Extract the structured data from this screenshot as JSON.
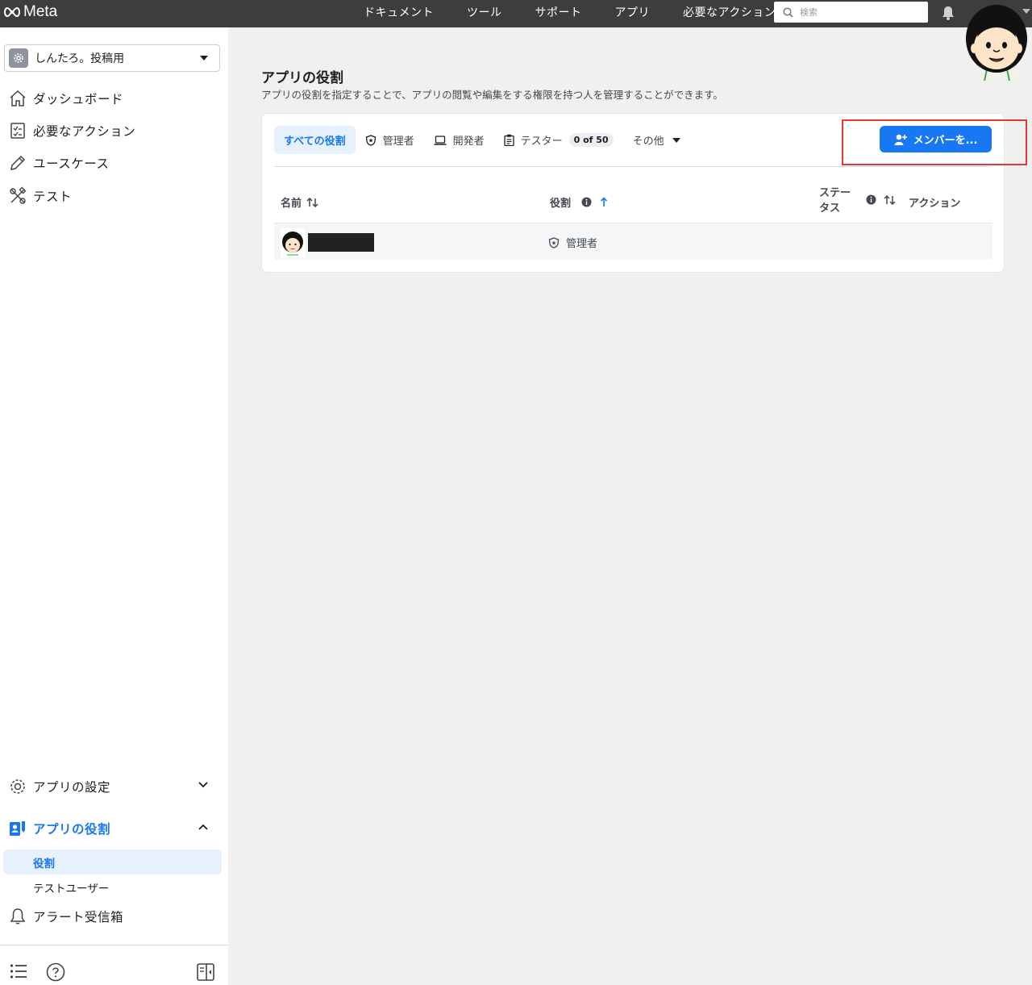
{
  "topbar": {
    "logo_text": "Meta",
    "nav": [
      "ドキュメント",
      "ツール",
      "サポート",
      "アプリ",
      "必要なアクション"
    ],
    "search_placeholder": "検索"
  },
  "sidebar": {
    "app_name": "しんたろ。投稿用",
    "items": [
      {
        "label": "ダッシュボード",
        "icon": "home-icon"
      },
      {
        "label": "必要なアクション",
        "icon": "checklist-icon"
      },
      {
        "label": "ユースケース",
        "icon": "pencil-icon"
      },
      {
        "label": "テスト",
        "icon": "tools-icon"
      }
    ],
    "settings": {
      "label": "アプリの設定",
      "icon": "gear-icon"
    },
    "roles": {
      "label": "アプリの役割",
      "icon": "roles-icon"
    },
    "sub_items": [
      "役割",
      "テストユーザー"
    ],
    "alerts": {
      "label": "アラート受信箱",
      "icon": "bell-icon"
    }
  },
  "main": {
    "title": "アプリの役割",
    "description": "アプリの役割を指定することで、アプリの閲覧や編集をする権限を持つ人を管理することができます。",
    "tabs": {
      "all": "すべての役割",
      "admin": "管理者",
      "developer": "開発者",
      "tester": "テスター",
      "tester_count": "0 of 50",
      "other": "その他"
    },
    "add_button": "メンバーを...",
    "columns": {
      "name": "名前",
      "role": "役割",
      "status": "ステータス",
      "action": "アクション"
    },
    "rows": [
      {
        "role": "管理者"
      }
    ]
  },
  "colors": {
    "accent": "#1877f2",
    "topbar": "#3d3d3d",
    "highlight": "#e53935"
  }
}
